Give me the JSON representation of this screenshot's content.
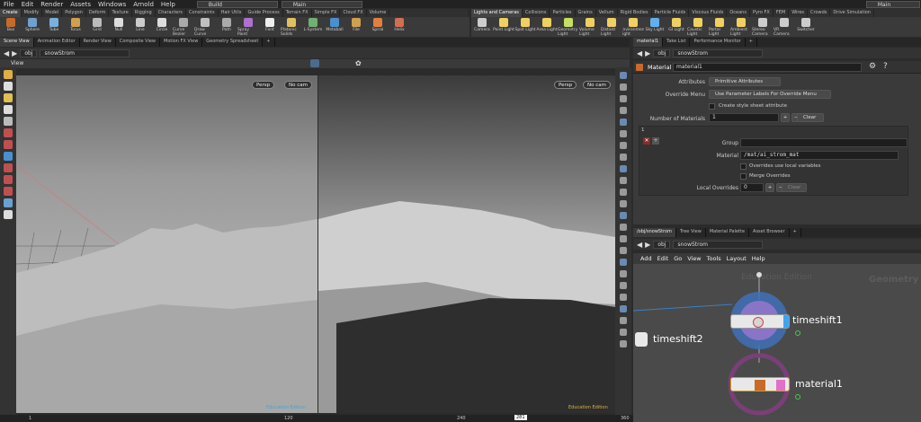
{
  "menu": {
    "items": [
      "File",
      "Edit",
      "Render",
      "Assets",
      "Windows",
      "Arnold",
      "Help"
    ],
    "desktop": "Build",
    "desktop2": "Main",
    "desktop3": "Main"
  },
  "shelf_left_tabs": [
    "Create",
    "Modify",
    "Model",
    "Polygon",
    "Deform",
    "Texture",
    "Rigging",
    "Characters",
    "Constraints",
    "Hair Utils",
    "Guide Process",
    "Terrain FX",
    "Simple FX",
    "Cloud FX",
    "Volume"
  ],
  "shelf_right_tabs": [
    "Lights and Cameras",
    "Collisions",
    "Particles",
    "Grains",
    "Vellum",
    "Rigid Bodies",
    "Particle Fluids",
    "Viscous Fluids",
    "Oceans",
    "Pyro FX",
    "FEM",
    "Wires",
    "Crowds",
    "Drive Simulation"
  ],
  "tools_left": [
    "Box",
    "Sphere",
    "Tube",
    "Torus",
    "Grid",
    "Null",
    "Line",
    "Circle",
    "Curve Bezier",
    "Draw Curve",
    "Path",
    "Spray Paint",
    "Font",
    "Platonic Solids",
    "L-System",
    "Metaball",
    "File",
    "Spiral",
    "Helix"
  ],
  "tools_right": [
    "Camera",
    "Point Light",
    "Spot Light",
    "Area Light",
    "Geometry Light",
    "Volume Light",
    "Distant Light",
    "Environment Light",
    "Sky Light",
    "GI Light",
    "Caustic Light",
    "Portal Light",
    "Ambient Light",
    "Stereo Camera",
    "VR Camera",
    "Switcher"
  ],
  "pane_tabs_left": [
    "Scene View",
    "Animation Editor",
    "Render View",
    "Composite View",
    "Motion FX View",
    "Geometry Spreadsheet"
  ],
  "pane_tabs_right": [
    "material1",
    "Take List",
    "Performance Monitor"
  ],
  "path": {
    "obj": "obj",
    "node": "snowStrom"
  },
  "viewport": {
    "title": "View",
    "persp": "Persp",
    "cam": "No cam",
    "edu": "Education Edition"
  },
  "params": {
    "node_type": "Material",
    "node_name": "material1",
    "attributes_label": "Attributes",
    "attributes_value": "Primitive Attributes",
    "override_label": "Override Menu",
    "override_value": "Use Parameter Labels For Override Menu",
    "style_sheet": "Create style sheet attribute",
    "num_label": "Number of Materials",
    "num_value": "1",
    "clear": "Clear",
    "multi_index": "1",
    "group_label": "Group",
    "group_value": "",
    "material_label": "Material",
    "material_value": "/mat/ai_strom_mat",
    "overrides_local": "Overrides use local variables",
    "merge": "Merge Overrides",
    "local_label": "Local Overrides",
    "local_value": "0",
    "clear2": "Clear"
  },
  "net_tabs": [
    "/obj/snowStrom",
    "Tree View",
    "Material Palette",
    "Asset Browser"
  ],
  "net_menu": [
    "Add",
    "Edit",
    "Go",
    "View",
    "Tools",
    "Layout",
    "Help"
  ],
  "network": {
    "watermark1": "Education Edition",
    "watermark2": "Geometry",
    "nodes": [
      "timeshift1",
      "timeshift2",
      "material1"
    ]
  },
  "timeline": {
    "ticks": [
      "1",
      "",
      "",
      "120",
      "",
      "",
      "240",
      "",
      "",
      "360"
    ],
    "frame": "281"
  }
}
